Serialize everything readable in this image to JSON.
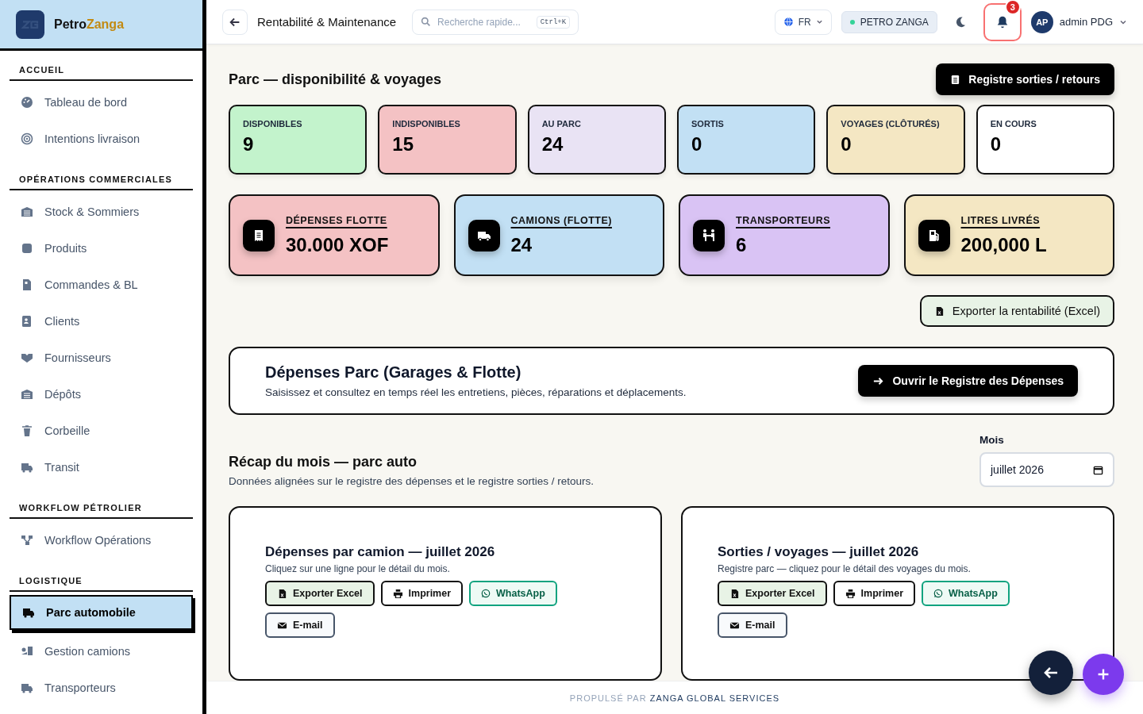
{
  "sidebar": {
    "brand": {
      "first": "Petro",
      "second": "Zanga"
    },
    "sections": [
      {
        "title": "ACCUEIL",
        "items": [
          {
            "label": "Tableau de bord",
            "selected": false
          },
          {
            "label": "Intentions livraison",
            "selected": false
          }
        ]
      },
      {
        "title": "OPÉRATIONS COMMERCIALES",
        "items": [
          {
            "label": "Stock & Sommiers",
            "selected": false
          },
          {
            "label": "Produits",
            "selected": false
          },
          {
            "label": "Commandes & BL",
            "selected": false
          },
          {
            "label": "Clients",
            "selected": false
          },
          {
            "label": "Fournisseurs",
            "selected": false
          },
          {
            "label": "Dépôts",
            "selected": false
          },
          {
            "label": "Corbeille",
            "selected": false
          },
          {
            "label": "Transit",
            "selected": false
          }
        ]
      },
      {
        "title": "WORKFLOW PÉTROLIER",
        "items": [
          {
            "label": "Workflow Opérations",
            "selected": false
          }
        ]
      },
      {
        "title": "LOGISTIQUE",
        "items": [
          {
            "label": "Parc automobile",
            "selected": true
          },
          {
            "label": "Gestion camions",
            "selected": false
          },
          {
            "label": "Transporteurs",
            "selected": false
          }
        ]
      }
    ]
  },
  "topbar": {
    "title": "Rentabilité & Maintenance",
    "search": {
      "placeholder": "Recherche rapide...",
      "shortcut": "Ctrl+K"
    },
    "language": "FR",
    "company": "PETRO ZANGA",
    "notifications": "3",
    "user": {
      "initials": "AP",
      "name": "admin PDG"
    }
  },
  "fleet": {
    "title": "Parc — disponibilité & voyages",
    "register_button": "Registre sorties / retours",
    "stats": [
      {
        "label": "DISPONIBLES",
        "value": "9",
        "color": "#c3f3cc"
      },
      {
        "label": "INDISPONIBLES",
        "value": "15",
        "color": "#f4c2c4"
      },
      {
        "label": "AU PARC",
        "value": "24",
        "color": "#e9e3f4"
      },
      {
        "label": "SORTIS",
        "value": "0",
        "color": "#c2e0f4"
      },
      {
        "label": "VOYAGES (CLÔTURÉS)",
        "value": "0",
        "color": "#f4e7c3"
      },
      {
        "label": "EN COURS",
        "value": "0",
        "color": "#ffffff"
      }
    ],
    "kpis": [
      {
        "label": "DÉPENSES FLOTTE",
        "value": "30.000 XOF",
        "color": "#f4c2c4"
      },
      {
        "label": "CAMIONS (FLOTTE)",
        "value": "24",
        "color": "#c2e0f4"
      },
      {
        "label": "TRANSPORTEURS",
        "value": "6",
        "color": "#d9c3f4"
      },
      {
        "label": "LITRES LIVRÉS",
        "value": "200,000 L",
        "color": "#f4e7c3"
      }
    ],
    "export_button": "Exporter la rentabilité (Excel)"
  },
  "expenses": {
    "title": "Dépenses Parc (Garages & Flotte)",
    "subtitle": "Saisissez et consultez en temps réel les entretiens, pièces, réparations et déplacements.",
    "button": "Ouvrir le Registre des Dépenses"
  },
  "recap": {
    "title": "Récap du mois — parc auto",
    "subtitle": "Données alignées sur le registre des dépenses et le registre sorties / retours.",
    "month_label": "Mois",
    "month_value": "juillet 2026",
    "panels": [
      {
        "title": "Dépenses par camion — juillet 2026",
        "subtitle": "Cliquez sur une ligne pour le détail du mois.",
        "actions": [
          {
            "kind": "excel",
            "label": "Exporter Excel"
          },
          {
            "kind": "print",
            "label": "Imprimer"
          },
          {
            "kind": "whatsapp",
            "label": "WhatsApp"
          },
          {
            "kind": "email",
            "label": "E-mail"
          }
        ]
      },
      {
        "title": "Sorties / voyages — juillet 2026",
        "subtitle": "Registre parc — cliquez pour le détail des voyages du mois.",
        "actions": [
          {
            "kind": "excel",
            "label": "Exporter Excel"
          },
          {
            "kind": "print",
            "label": "Imprimer"
          },
          {
            "kind": "whatsapp",
            "label": "WhatsApp"
          },
          {
            "kind": "email",
            "label": "E-mail"
          }
        ]
      }
    ]
  },
  "footer": {
    "prefix": "PROPULSÉ PAR",
    "brand": "ZANGA GLOBAL SERVICES"
  }
}
